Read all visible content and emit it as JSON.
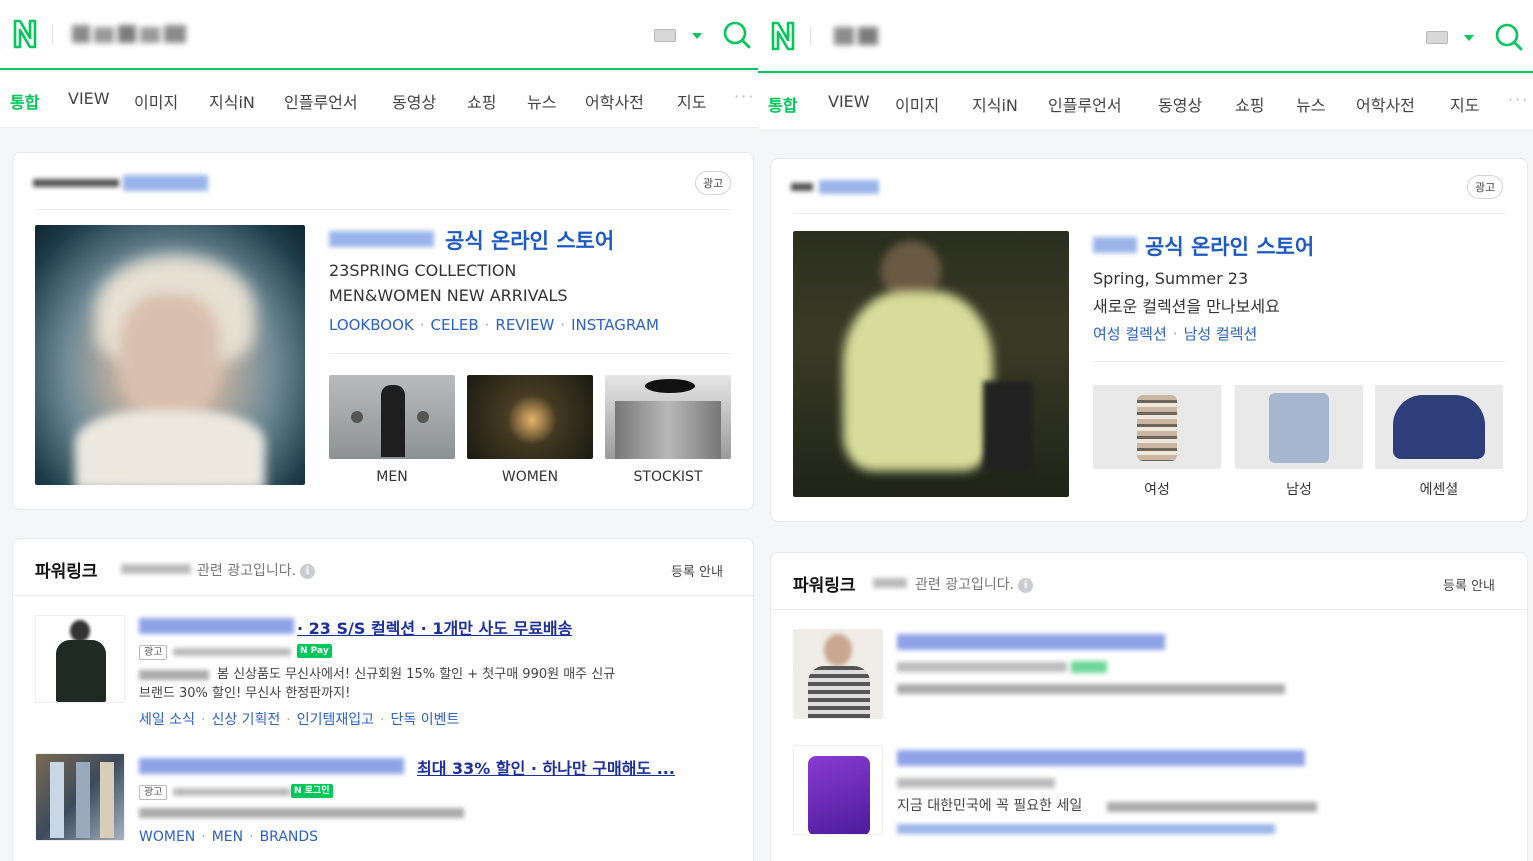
{
  "left": {
    "tabs": [
      "통합",
      "VIEW",
      "이미지",
      "지식iN",
      "인플루언서",
      "동영상",
      "쇼핑",
      "뉴스",
      "어학사전",
      "지도"
    ],
    "more": "···",
    "ad_chip": "광고",
    "brand": {
      "title": "공식 온라인 스토어",
      "desc1": "23SPRING COLLECTION",
      "desc2": "MEN&WOMEN NEW ARRIVALS",
      "links": [
        "LOOKBOOK",
        "CELEB",
        "REVIEW",
        "INSTAGRAM"
      ],
      "thumbs": [
        "MEN",
        "WOMEN",
        "STOCKIST"
      ]
    },
    "powerlink": {
      "title": "파워링크",
      "sub": "관련 광고입니다.",
      "reg": "등록 안내",
      "ad1": {
        "title": "· 23 S/S 컬렉션 · 1개만 사도 무료배송",
        "badge": "광고",
        "npay": "N Pay",
        "desc1": "봄 신상품도 무신사에서! 신규회원 15% 할인 + 첫구매 990원 매주 신규",
        "desc2": "브랜드 30% 할인! 무신사 한정판까지!",
        "links": [
          "세일 소식",
          "신상 기획전",
          "인기템재입고",
          "단독 이벤트"
        ]
      },
      "ad2": {
        "title": "최대 33% 할인 · 하나만 구매해도 ...",
        "badge": "광고",
        "npay": "N 로그인",
        "links": [
          "WOMEN",
          "MEN",
          "BRANDS"
        ]
      }
    }
  },
  "right": {
    "tabs": [
      "통합",
      "VIEW",
      "이미지",
      "지식iN",
      "인플루언서",
      "동영상",
      "쇼핑",
      "뉴스",
      "어학사전",
      "지도"
    ],
    "more": "···",
    "ad_chip": "광고",
    "brand": {
      "title": "공식 온라인 스토어",
      "desc1": "Spring, Summer 23",
      "desc2": "새로운 컬렉션을 만나보세요",
      "links": [
        "여성 컬렉션",
        "남성 컬렉션"
      ],
      "thumbs": [
        "여성",
        "남성",
        "에센셜"
      ]
    },
    "powerlink": {
      "title": "파워링크",
      "sub": "관련 광고입니다.",
      "reg": "등록 안내",
      "ad2_desc_start": "지금 대한민국에 꼭 필요한 세일"
    }
  },
  "colors": {
    "naver_green": "#03c75a",
    "link_blue": "#2b61c9",
    "title_blue": "#1c5bc4",
    "ad_title_navy": "#1d2f9c"
  }
}
